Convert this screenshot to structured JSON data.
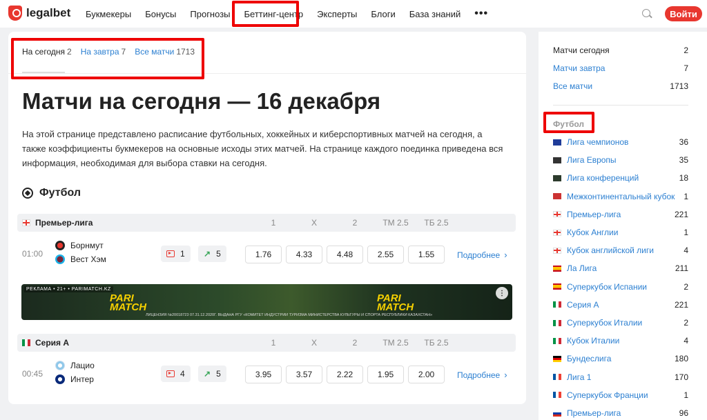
{
  "header": {
    "logo_text": "legalbet",
    "nav": [
      "Букмекеры",
      "Бонусы",
      "Прогнозы",
      "Беттинг-центр",
      "Эксперты",
      "Блоги",
      "База знаний"
    ],
    "more": "•••",
    "login": "Войти"
  },
  "tabs": [
    {
      "label": "На сегодня",
      "count": "2",
      "active": true
    },
    {
      "label": "На завтра",
      "count": "7",
      "active": false
    },
    {
      "label": "Все матчи",
      "count": "1713",
      "active": false
    }
  ],
  "page_title": "Матчи на сегодня — 16 декабря",
  "description": "На этой странице представлено расписание футбольных, хоккейных и киберспортивных матчей на сегодня, а также коэффициенты букмекеров на основные исходы этих матчей. На странице каждого поединка приведена вся информация, необходимая для выбора ставки на сегодня.",
  "section_title": "Футбол",
  "columns": [
    "1",
    "X",
    "2",
    "ТМ 2.5",
    "ТБ 2.5"
  ],
  "leagues": [
    {
      "name": "Премьер-лига",
      "match": {
        "time": "01:00",
        "home": "Борнмут",
        "away": "Вест Хэм",
        "video_count": "1",
        "trend_count": "5",
        "odds": [
          "1.76",
          "4.33",
          "4.48",
          "2.55",
          "1.55"
        ],
        "more": "Подробнее"
      }
    },
    {
      "name": "Серия А",
      "match": {
        "time": "00:45",
        "home": "Лацио",
        "away": "Интер",
        "video_count": "4",
        "trend_count": "5",
        "odds": [
          "3.95",
          "3.57",
          "2.22",
          "1.95",
          "2.00"
        ],
        "more": "Подробнее"
      }
    }
  ],
  "banner": {
    "top": "РЕКЛАМА • 21+ • PARIMATCH.KZ",
    "logo_line1": "PARI",
    "logo_line2": "MATCH",
    "legal": "ЛИЦЕНЗИЯ №20018723 07.31.12.2020Г. ВЫДАНА РГУ «КОМИТЕТ ИНДУСТРИИ ТУРИЗМА МИНИСТЕРСТВА КУЛЬТУРЫ И СПОРТА РЕСПУБЛИКИ КАЗАХСТАН»"
  },
  "sidebar": {
    "top": [
      {
        "label": "Матчи сегодня",
        "count": "2",
        "active": true
      },
      {
        "label": "Матчи завтра",
        "count": "7",
        "active": false
      },
      {
        "label": "Все матчи",
        "count": "1713",
        "active": false
      }
    ],
    "section": "Футбол",
    "leagues": [
      {
        "name": "Лига чемпионов",
        "count": "36",
        "flag": "eu"
      },
      {
        "name": "Лига Европы",
        "count": "35",
        "flag": "trophy"
      },
      {
        "name": "Лига конференций",
        "count": "18",
        "flag": "trophy2"
      },
      {
        "name": "Межконтинентальный кубок",
        "count": "1",
        "flag": "world"
      },
      {
        "name": "Премьер-лига",
        "count": "221",
        "flag": "en"
      },
      {
        "name": "Кубок Англии",
        "count": "1",
        "flag": "en"
      },
      {
        "name": "Кубок английской лиги",
        "count": "4",
        "flag": "en"
      },
      {
        "name": "Ла Лига",
        "count": "211",
        "flag": "es"
      },
      {
        "name": "Суперкубок Испании",
        "count": "2",
        "flag": "es"
      },
      {
        "name": "Серия А",
        "count": "221",
        "flag": "it"
      },
      {
        "name": "Суперкубок Италии",
        "count": "2",
        "flag": "it"
      },
      {
        "name": "Кубок Италии",
        "count": "4",
        "flag": "it"
      },
      {
        "name": "Бундеслига",
        "count": "180",
        "flag": "de"
      },
      {
        "name": "Лига 1",
        "count": "170",
        "flag": "fr"
      },
      {
        "name": "Суперкубок Франции",
        "count": "1",
        "flag": "fr"
      },
      {
        "name": "Премьер-лига",
        "count": "96",
        "flag": "ru"
      }
    ]
  },
  "colors": {
    "brand": "#e8372f",
    "link": "#2b7fd1",
    "highlight": "#e00000"
  }
}
